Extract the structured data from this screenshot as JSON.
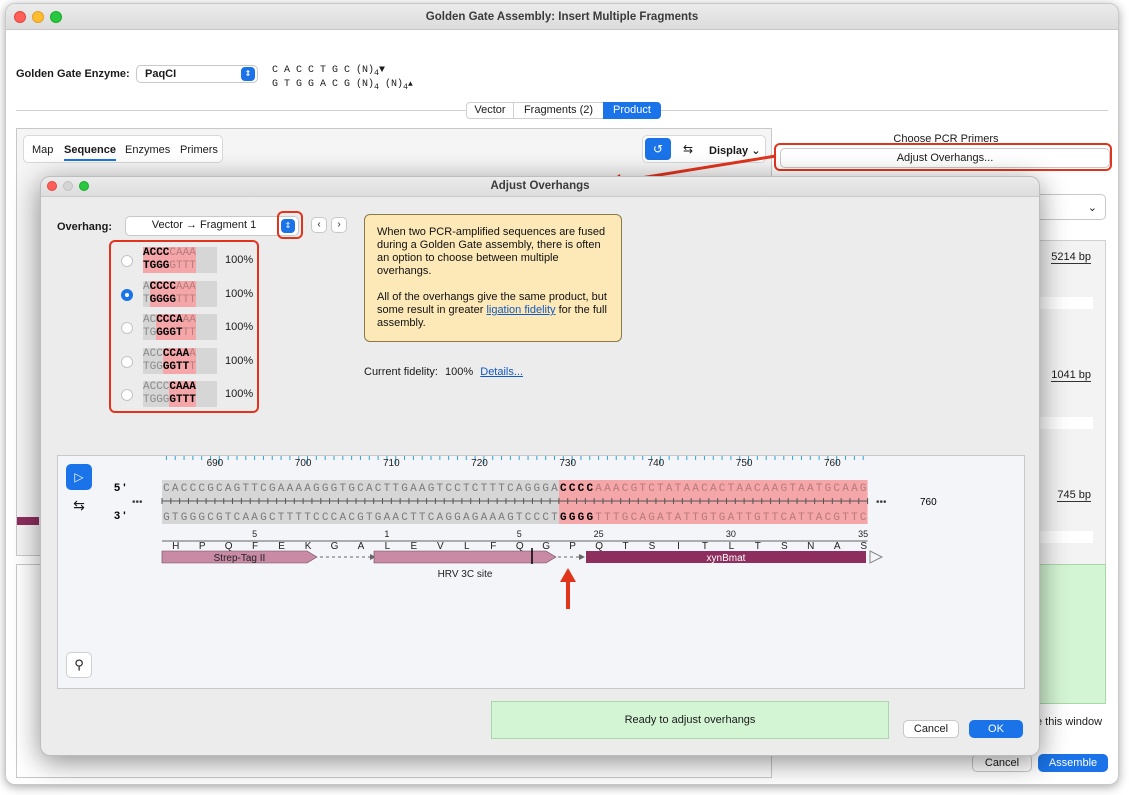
{
  "main_window": {
    "title": "Golden Gate Assembly: Insert Multiple Fragments",
    "enzyme_label": "Golden Gate Enzyme:",
    "enzyme_value": "PaqCI",
    "site_top": "C A C C T G C (N)",
    "site_top_sub": "4",
    "site_bottom": "G T G G A C G (N)",
    "site_bottom_sub": "4",
    "site_bottom_suffix": " (N)",
    "site_bottom_suffix_sub": "4",
    "tabs": [
      "Vector",
      "Fragments (2)",
      "Product"
    ],
    "active_tab": "Product",
    "view_tabs": [
      "Map",
      "Sequence",
      "Enzymes",
      "Primers"
    ],
    "active_view_tab": "Sequence",
    "display_label": "Display",
    "choose_pcr_primers": "Choose PCR Primers",
    "adjust_overhangs_button": "Adjust Overhangs...",
    "sizes": [
      "5214 bp",
      "1041 bp",
      "745 bp"
    ],
    "close_window_text": "e this window",
    "cancel_label": "Cancel",
    "assemble_label": "Assemble"
  },
  "dialog": {
    "title": "Adjust Overhangs",
    "overhang_label": "Overhang:",
    "overhang_value": "Vector → Fragment 1",
    "options": [
      {
        "top": [
          "ACCC",
          "CAAA"
        ],
        "bottom": [
          "TGGG",
          "GTTT"
        ],
        "offset": 0,
        "pct": "100%",
        "selected": false
      },
      {
        "top": [
          "A",
          "CCCC",
          "AAA"
        ],
        "bottom": [
          "T",
          "GGGG",
          "TTT"
        ],
        "offset": 1,
        "pct": "100%",
        "selected": true
      },
      {
        "top": [
          "AC",
          "CCCA",
          "AA"
        ],
        "bottom": [
          "TG",
          "GGGT",
          "TT"
        ],
        "offset": 2,
        "pct": "100%",
        "selected": false
      },
      {
        "top": [
          "ACC",
          "CCAA",
          "A"
        ],
        "bottom": [
          "TGG",
          "GGTT",
          "T"
        ],
        "offset": 3,
        "pct": "100%",
        "selected": false
      },
      {
        "top": [
          "ACCC",
          "CAAA"
        ],
        "bottom": [
          "TGGG",
          "GTTT"
        ],
        "offset": 4,
        "pct": "100%",
        "selected": false
      }
    ],
    "info_p1": "When two PCR-amplified sequences are fused during a Golden Gate assembly, there is often an option to choose between multiple overhangs.",
    "info_p2_a": "All of the overhangs give the same product, but some result in greater ",
    "info_p2_link": "ligation fidelity",
    "info_p2_b": " for the full assembly.",
    "fidelity_label": "Current fidelity:",
    "fidelity_value": "100%",
    "details_link": "Details...",
    "status": "Ready to adjust overhangs",
    "cancel_label": "Cancel",
    "ok_label": "OK"
  },
  "sequence_view": {
    "ruler": [
      "690",
      "700",
      "710",
      "720",
      "730",
      "740",
      "750",
      "760"
    ],
    "end_number": "760",
    "strand5": "5 '",
    "strand3": "3 '",
    "ellipsis": "•••",
    "top_grey": "CACCCGCAGTTCGAAAAGGGTGCACTTGAAGTCCTCTTTCAGGGA",
    "top_bold": "CCCC",
    "top_red": "AAACGTCTATAACACTAACAAGTAATGCAAG",
    "bot_grey": "GTGGGCGTCAAGCTTTTCCCACGTGAACTTCAGGAGAAAGTCCCT",
    "bot_bold": "GGGG",
    "bot_red": "TTTGCAGATATTGTGATTGTTCATTACGTTC",
    "aa_numbers": [
      "5",
      "1",
      "5",
      "25",
      "30",
      "35"
    ],
    "amino_acids": [
      "H",
      "P",
      "Q",
      "F",
      "E",
      "K",
      "G",
      "A",
      "L",
      "E",
      "V",
      "L",
      "F",
      "Q",
      "G",
      "P",
      "Q",
      "T",
      "S",
      "I",
      "T",
      "L",
      "T",
      "S",
      "N",
      "A",
      "S"
    ],
    "features": [
      "Strep-Tag II",
      "HRV 3C site",
      "xynBmat"
    ]
  },
  "colors": {
    "accent": "#1a73e8",
    "highlight_red": "#e2341d",
    "overhang_pink": "#f4a6a9",
    "feature_pink": "#c98aa6",
    "feature_maroon": "#8e2e5e",
    "info_yellow": "#fde9b8",
    "status_green": "#d4f5d4"
  }
}
